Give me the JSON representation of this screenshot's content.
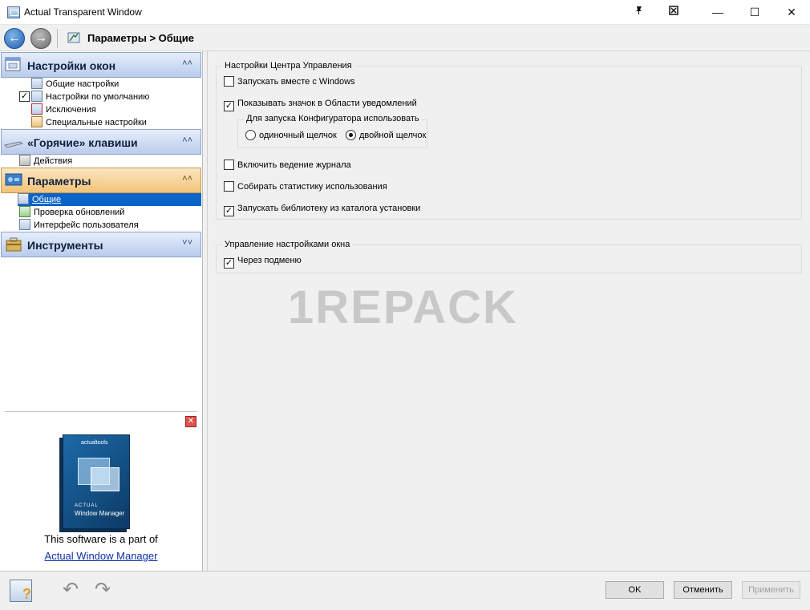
{
  "window": {
    "title": "Actual Transparent Window",
    "controls": {
      "minimize": "—",
      "maximize": "☐",
      "close": "✕"
    },
    "extra_buttons": [
      "pin-icon",
      "rollup-icon"
    ]
  },
  "nav": {
    "breadcrumb": "Параметры > Общие"
  },
  "sidebar": {
    "groups": [
      {
        "title": "Настройки окон",
        "items": [
          {
            "label": "Общие настройки"
          },
          {
            "label": "Настройки по умолчанию",
            "checked": true
          },
          {
            "label": "Исключения"
          },
          {
            "label": "Специальные настройки"
          }
        ]
      },
      {
        "title": "«Горячие» клавиши",
        "items": [
          {
            "label": "Действия"
          }
        ]
      },
      {
        "title": "Параметры",
        "items": [
          {
            "label": "Общие",
            "selected": true
          },
          {
            "label": "Проверка обновлений"
          },
          {
            "label": "Интерфейс пользователя"
          }
        ]
      },
      {
        "title": "Инструменты",
        "items": []
      }
    ],
    "promo": {
      "box_brand": "actualtools",
      "box_title_small": "ACTUAL",
      "box_title": "Window Manager",
      "line1": "This software is a part of",
      "link": "Actual Window Manager"
    }
  },
  "main": {
    "group1": {
      "legend": "Настройки Центра Управления",
      "options": [
        {
          "label": "Запускать вместе с Windows",
          "checked": false
        },
        {
          "label": "Показывать значок в Области уведомлений",
          "checked": true
        },
        {
          "label": "Включить ведение журнала",
          "checked": false
        },
        {
          "label": "Собирать статистику использования",
          "checked": false
        },
        {
          "label": "Запускать библиотеку из каталога установки",
          "checked": true
        }
      ],
      "subgroup": {
        "legend": "Для запуска Конфигуратора использовать",
        "radios": [
          {
            "label": "одиночный щелчок",
            "selected": false
          },
          {
            "label": "двойной щелчок",
            "selected": true
          }
        ]
      }
    },
    "group2": {
      "legend": "Управление настройками окна",
      "options": [
        {
          "label": "Через подменю",
          "checked": true
        }
      ]
    },
    "watermark": "1REPACK"
  },
  "footer": {
    "ok": "OK",
    "cancel": "Отменить",
    "apply": "Применить"
  }
}
